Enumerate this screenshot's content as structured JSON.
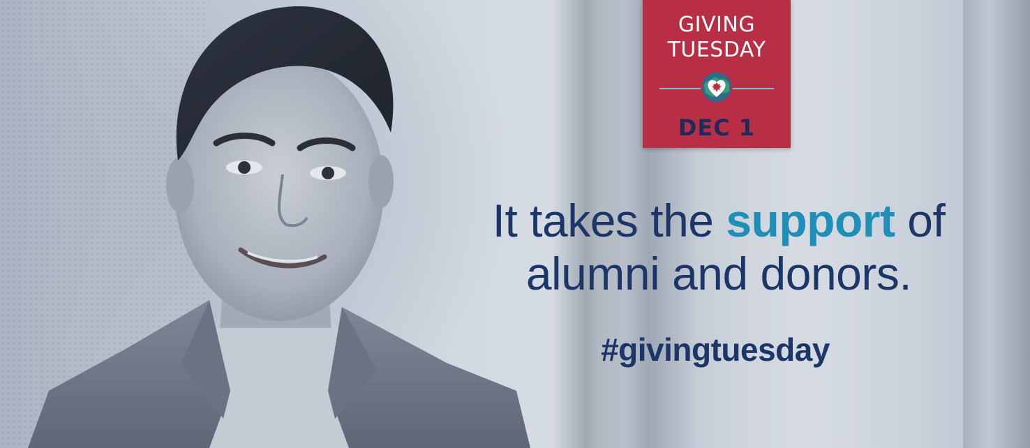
{
  "logo": {
    "line1": "GIVING",
    "line2": "TUESDAY",
    "date": "DEC 1",
    "icon": "globe-heart-maple-leaf-icon",
    "colors": {
      "badge": "#b72e45",
      "date_text": "#1f2a5c"
    }
  },
  "headline": {
    "part1": "It takes the ",
    "accent": "support",
    "part2": " of",
    "line2": "alumni and donors.",
    "colors": {
      "text": "#1c3668",
      "accent": "#1f8fb7"
    }
  },
  "hashtag": "#givingtuesday",
  "photo": {
    "icon": "portrait-photo"
  }
}
